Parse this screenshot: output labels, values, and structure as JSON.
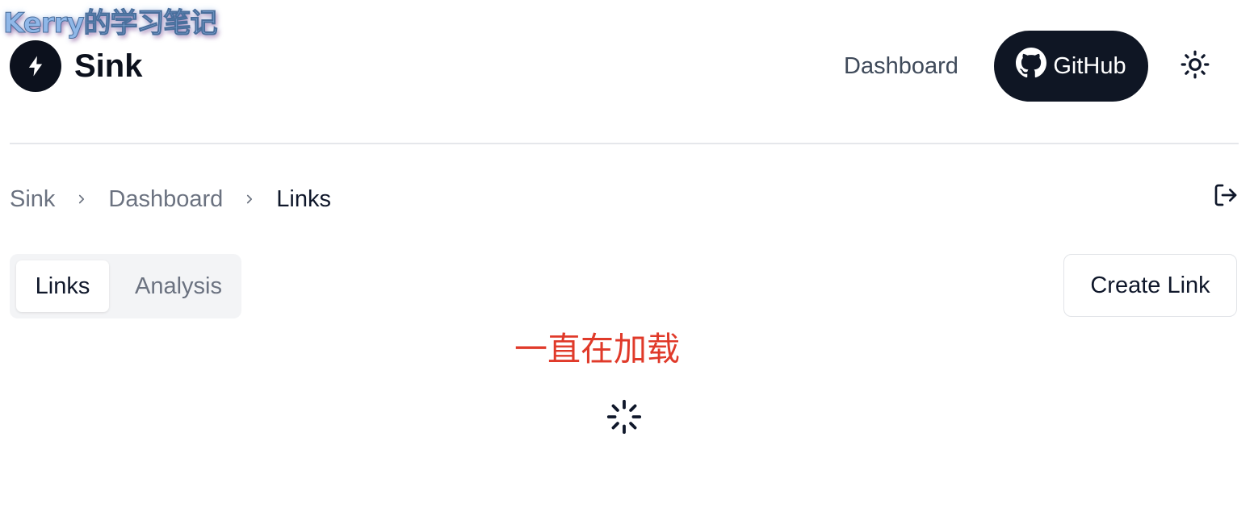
{
  "watermark": {
    "text": "Kerry的学习笔记"
  },
  "header": {
    "brand_icon": "lightning-bolt-icon",
    "brand_name": "Sink",
    "nav_dashboard": "Dashboard",
    "github_label": "GitHub",
    "github_icon": "github-icon",
    "theme_icon": "sun-icon"
  },
  "breadcrumb": {
    "items": [
      "Sink",
      "Dashboard",
      "Links"
    ],
    "separator_icon": "chevron-right-icon",
    "logout_icon": "logout-icon"
  },
  "tabs": [
    {
      "label": "Links",
      "active": true
    },
    {
      "label": "Analysis",
      "active": false
    }
  ],
  "actions": {
    "create_link": "Create Link"
  },
  "annotation": {
    "text": "一直在加载"
  },
  "loading": {
    "icon": "loader-icon"
  },
  "colors": {
    "primary_dark": "#0f1624",
    "muted_text": "#6b7280",
    "annotation_red": "#e03a2a",
    "tab_bg": "#f3f4f6"
  }
}
